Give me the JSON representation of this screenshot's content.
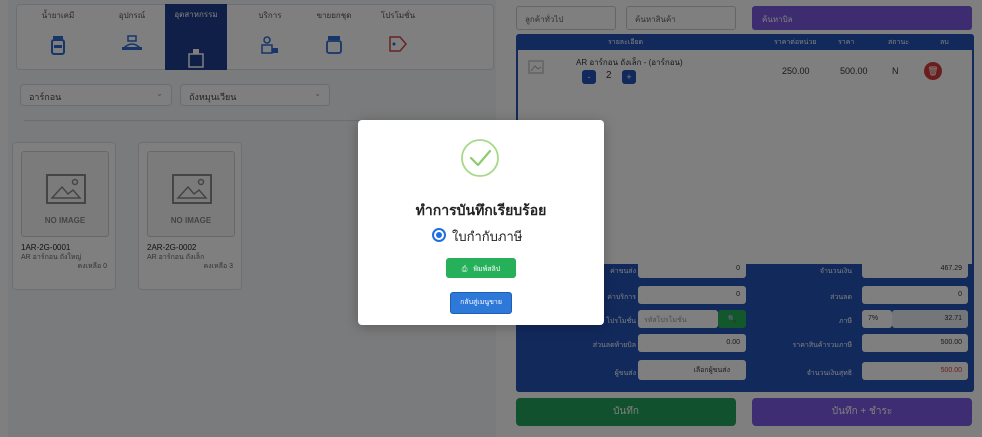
{
  "categories": [
    {
      "label": "น้ำยาเคมี"
    },
    {
      "label": "อุปกรณ์"
    },
    {
      "label": "อุตสาหกรรม"
    },
    {
      "label": "บริการ"
    },
    {
      "label": "ขายยกชุด"
    },
    {
      "label": "โปรโมชั่น"
    }
  ],
  "filters": {
    "brand": "อาร์กอน",
    "type": "ถังหมุนเวียน"
  },
  "products": [
    {
      "noimage": "NO IMAGE",
      "code": "1AR-2G-0001",
      "name": "AR อาร์กอน ถังใหญ่",
      "stock": "คงเหลือ 0"
    },
    {
      "noimage": "NO IMAGE",
      "code": "2AR-2G-0002",
      "name": "AR อาร์กอน ถังเล็ก",
      "stock": "คงเหลือ 3"
    }
  ],
  "top": {
    "customer": "ลูกค้าทั่วไป",
    "search": "ค้นหาสินค้า",
    "button": "ค้นหาบิล"
  },
  "cart": {
    "headers": [
      "รายละเอียด",
      "ราคาต่อหน่วย",
      "ราคา",
      "สถานะ",
      "ลบ"
    ],
    "item": {
      "name": "AR อาร์กอน ถังเล็ก - (อาร์กอน)",
      "qty": "2",
      "unit_price": "250.00",
      "price": "500.00",
      "status": "N",
      "minus": "-",
      "plus": "+"
    }
  },
  "summary": {
    "left": [
      {
        "label": "ค่าขนส่ง",
        "value": "0"
      },
      {
        "label": "ค่าบริการ",
        "value": "0"
      },
      {
        "label": "โปรโมชั่น",
        "value": "รหัสโปรโมชั่น"
      },
      {
        "label": "ส่วนลดท้ายบิล",
        "value": "0.00"
      },
      {
        "label": "ผู้ขนส่ง",
        "value": "เลือกผู้ขนส่ง"
      }
    ],
    "right": [
      {
        "label": "จำนวนเงิน",
        "value": "467.29"
      },
      {
        "label": "ส่วนลด",
        "value": "0"
      },
      {
        "label": "ภาษี",
        "value": "32.71",
        "rate": "7%"
      },
      {
        "label": "ราคาสินค้ารวมภาษี",
        "value": "500.00"
      },
      {
        "label": "จำนวนเงินสุทธิ",
        "value": "500.00"
      }
    ]
  },
  "actions": {
    "save": "บันทึก",
    "save_pay": "บันทึก + ชำระ"
  },
  "modal": {
    "title": "ทำการบันทึกเรียบร้อย",
    "radio_label": "ใบกำกับภาษี",
    "print_button": "พิมพ์สลิป",
    "back_button": "กลับสู่เมนูขาย"
  },
  "colors": {
    "primary_blue": "#2453b8",
    "success_green": "#27b05a",
    "purple": "#7d5be4",
    "danger_red": "#d63a3a"
  }
}
